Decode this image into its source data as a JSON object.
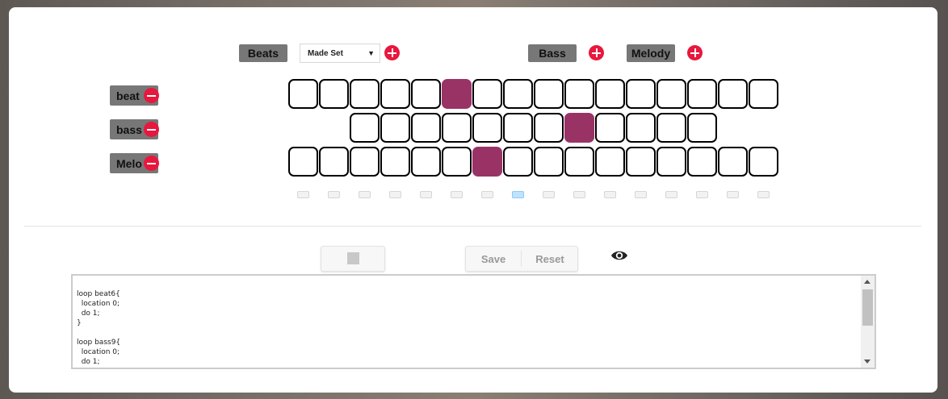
{
  "header": {
    "beats_label": "Beats",
    "bass_label": "Bass",
    "melody_label": "Melody",
    "set_select": {
      "value": "Made Set",
      "arrow": "▼"
    }
  },
  "tracks": [
    {
      "label": "beat",
      "steps": [
        0,
        0,
        0,
        0,
        0,
        1,
        0,
        0,
        0,
        0,
        0,
        0,
        0,
        0,
        0,
        0
      ]
    },
    {
      "label": "bass",
      "steps": [
        0,
        0,
        0,
        0,
        0,
        0,
        0,
        1,
        0,
        0,
        0,
        0
      ]
    },
    {
      "label": "Melo",
      "steps": [
        0,
        0,
        0,
        0,
        0,
        0,
        1,
        0,
        0,
        0,
        0,
        0,
        0,
        0,
        0,
        0
      ]
    }
  ],
  "step_indicator": {
    "count": 16,
    "active_index": 7
  },
  "controls": {
    "save_label": "Save",
    "reset_label": "Reset"
  },
  "code": {
    "text": "loop beat6{\n  location 0;\n  do 1;\n}\n\nloop bass9{\n  location 0;\n  do 1;"
  },
  "colors": {
    "active_cell": "#993366",
    "accent_plus_minus": "#e8173d",
    "label_bg": "#777777",
    "active_step": "#bfe3ff"
  }
}
